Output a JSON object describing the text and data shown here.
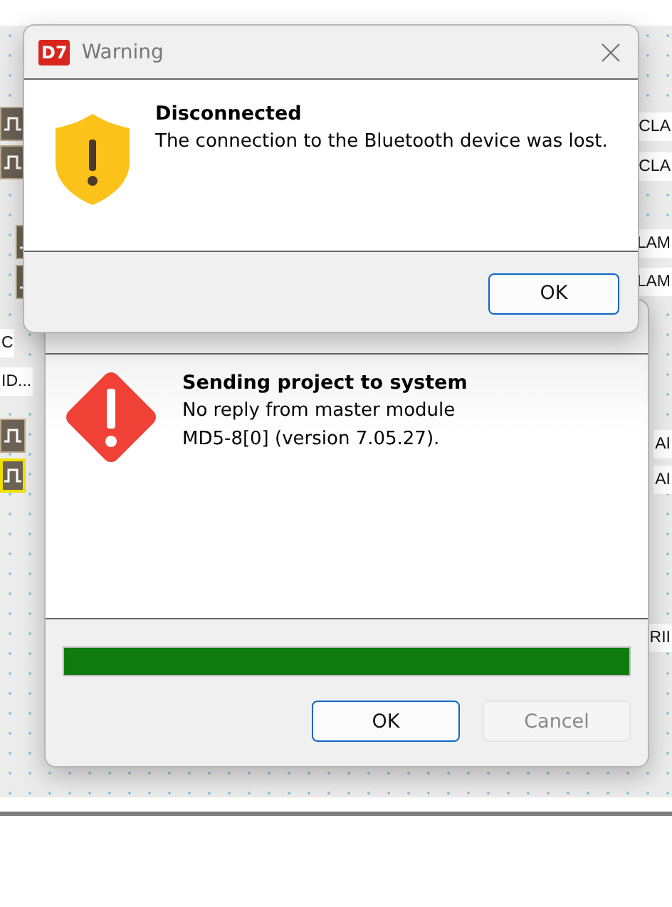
{
  "canvas": {
    "labels": [
      {
        "text": "CLA"
      },
      {
        "text": "CLA"
      },
      {
        "text": "LAM"
      },
      {
        "text": "LAM"
      },
      {
        "text": "C"
      },
      {
        "text": "ID..."
      },
      {
        "text": "AI"
      },
      {
        "text": "AI"
      },
      {
        "text": "RII"
      }
    ]
  },
  "warning_dialog": {
    "app_badge": "D7",
    "title": "Warning",
    "heading": "Disconnected",
    "message": "The connection to the Bluetooth device was lost.",
    "buttons": [
      {
        "label": "OK",
        "default": true,
        "disabled": false
      }
    ]
  },
  "send_dialog": {
    "heading": "Sending project to system",
    "message_lines": [
      "No reply from master module",
      "MD5-8[0] (version 7.05.27)."
    ],
    "progress": {
      "level": 1.0
    },
    "buttons": [
      {
        "label": "OK",
        "default": true,
        "disabled": false
      },
      {
        "label": "Cancel",
        "default": false,
        "disabled": true
      }
    ]
  }
}
